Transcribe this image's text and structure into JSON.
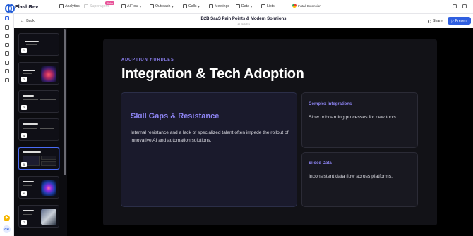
{
  "app": {
    "name": "FlashRev"
  },
  "nav": {
    "items": [
      {
        "label": "Analytics"
      },
      {
        "label": "Superagent",
        "badge": "Alpha"
      },
      {
        "label": "AIFlow"
      },
      {
        "label": "Outreach"
      },
      {
        "label": "Calls"
      },
      {
        "label": "Meetings"
      },
      {
        "label": "Data"
      },
      {
        "label": "Lists"
      }
    ],
    "extension_label": "Install Extension"
  },
  "doc": {
    "back_label": "Back",
    "title": "B2B SaaS Pain Points & Modern Solutions",
    "subtitle": "10 SLIDES",
    "share_label": "Share",
    "present_label": "Present"
  },
  "thumbnails": [
    {
      "number": "1"
    },
    {
      "number": "2"
    },
    {
      "number": "3"
    },
    {
      "number": "4"
    },
    {
      "number": "5",
      "selected": true
    },
    {
      "number": "6"
    },
    {
      "number": "7"
    }
  ],
  "slide": {
    "kicker": "ADOPTION HURDLES",
    "title": "Integration & Tech Adoption",
    "main_card": {
      "heading": "Skill Gaps & Resistance",
      "body": "Internal resistance and a lack of specialized talent often impede the rollout of innovative AI and automation solutions."
    },
    "cards": [
      {
        "heading": "Complex Integrations",
        "body": "Slow onboarding processes for new tools."
      },
      {
        "heading": "Siloed Data",
        "body": "Inconsistent data flow across platforms."
      }
    ]
  },
  "user": {
    "initials": "CH"
  },
  "colors": {
    "accent": "#2f5fe0",
    "slide_heading": "#8d84f2",
    "kicker": "#8b7ff0",
    "alpha_badge": "#e8559a"
  }
}
